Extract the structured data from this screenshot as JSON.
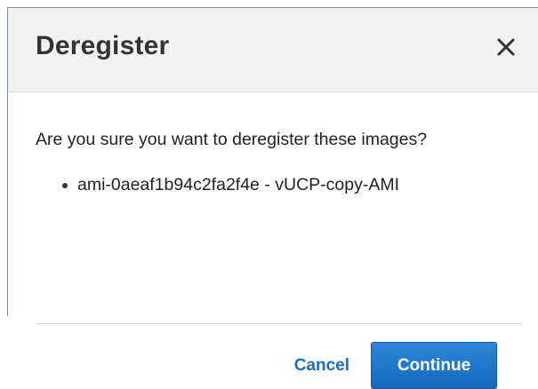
{
  "dialog": {
    "title": "Deregister",
    "close_icon": "close-icon",
    "question": "Are you sure you want to deregister these images?",
    "images": [
      {
        "label": "ami-0aeaf1b94c2fa2f4e - vUCP-copy-AMI"
      }
    ],
    "cancel_label": "Cancel",
    "continue_label": "Continue"
  },
  "colors": {
    "header_background": "#f2f2f2",
    "link": "#1a6fc4",
    "primary_button": "#1a72c8"
  }
}
